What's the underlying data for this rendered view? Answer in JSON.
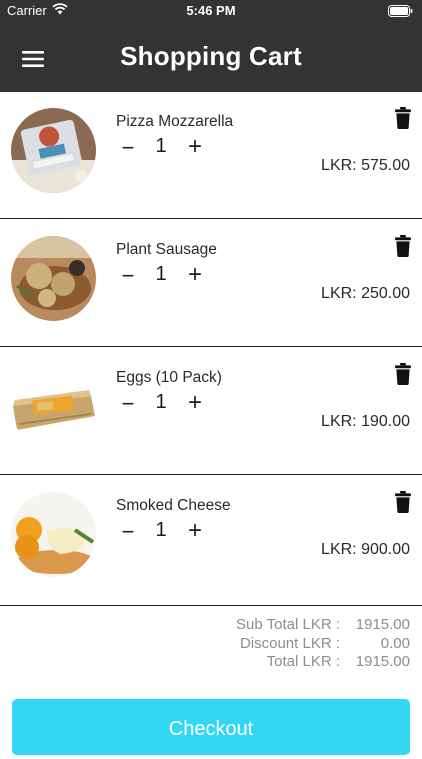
{
  "status_bar": {
    "carrier": "Carrier",
    "time": "5:46 PM"
  },
  "header": {
    "title": "Shopping Cart",
    "menu_icon": "hamburger-menu-icon"
  },
  "cart": {
    "minus_glyph": "−",
    "plus_glyph": "+",
    "items": [
      {
        "name": "Pizza Mozzarella",
        "quantity": "1",
        "price": "LKR: 575.00"
      },
      {
        "name": "Plant Sausage",
        "quantity": "1",
        "price": "LKR: 250.00"
      },
      {
        "name": "Eggs (10 Pack)",
        "quantity": "1",
        "price": "LKR: 190.00"
      },
      {
        "name": "Smoked Cheese",
        "quantity": "1",
        "price": "LKR: 900.00"
      }
    ]
  },
  "totals": {
    "subtotal_label": "Sub Total LKR :",
    "subtotal_value": "1915.00",
    "discount_label": "Discount LKR :",
    "discount_value": "0.00",
    "total_label": "Total LKR :",
    "total_value": "1915.00"
  },
  "checkout_label": "Checkout",
  "colors": {
    "header_bg": "#333333",
    "checkout_bg": "#33d6f5",
    "totals_text": "#8e8e8e"
  }
}
